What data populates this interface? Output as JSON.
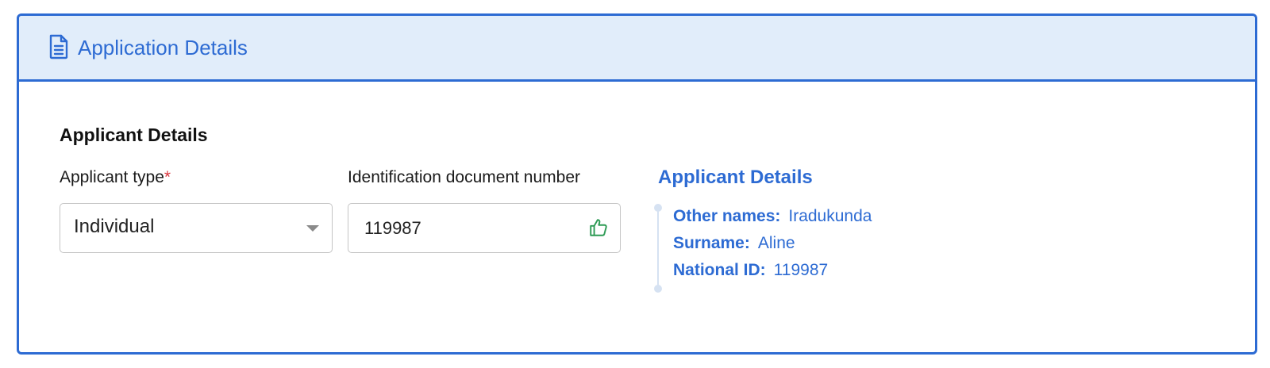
{
  "header": {
    "title": "Application Details",
    "icon": "document-icon"
  },
  "section": {
    "title": "Applicant Details"
  },
  "form": {
    "applicant_type": {
      "label": "Applicant type",
      "required_marker": "*",
      "value": "Individual"
    },
    "id_number": {
      "label": "Identification document number",
      "value": "119987",
      "status_icon": "thumbs-up-icon"
    }
  },
  "details_panel": {
    "title": "Applicant Details",
    "rows": [
      {
        "key": "Other names:",
        "value": "Iradukunda"
      },
      {
        "key": "Surname:",
        "value": "Aline"
      },
      {
        "key": "National ID:",
        "value": "119987"
      }
    ]
  },
  "colors": {
    "accent": "#2d6bd3",
    "header_bg": "#e1edfa",
    "required": "#d9363e",
    "success": "#2e9b55"
  }
}
